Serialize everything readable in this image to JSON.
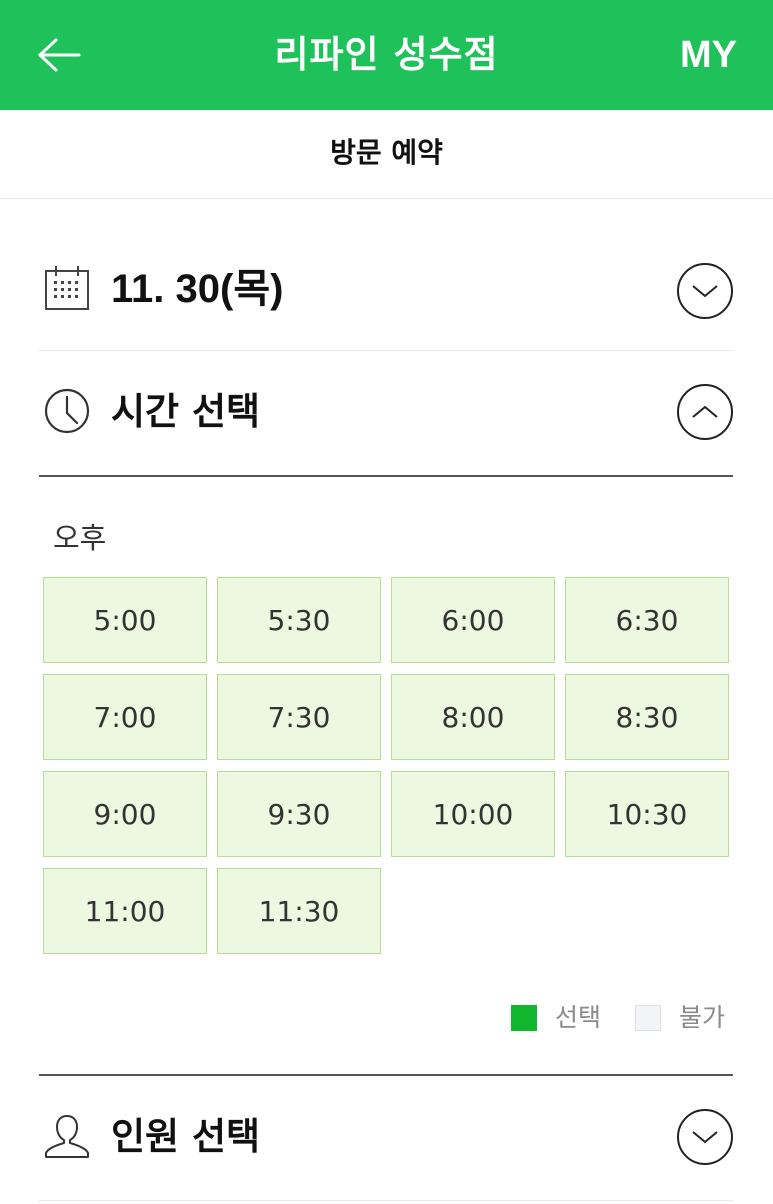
{
  "header": {
    "title": "리파인 성수점",
    "my_label": "MY",
    "bg_color": "#1ec15a"
  },
  "subheader": {
    "title": "방문 예약"
  },
  "date_section": {
    "icon": "calendar-icon",
    "value": "11. 30(목)",
    "toggle": "chevron-down-icon"
  },
  "time_section": {
    "icon": "clock-icon",
    "label": "시간 선택",
    "toggle": "chevron-up-icon",
    "period_label": "오후",
    "slots": [
      "5:00",
      "5:30",
      "6:00",
      "6:30",
      "7:00",
      "7:30",
      "8:00",
      "8:30",
      "9:00",
      "9:30",
      "10:00",
      "10:30",
      "11:00",
      "11:30"
    ],
    "slot_color": "#ecf8df"
  },
  "legend": {
    "selected_label": "선택",
    "selected_color": "#10b62d",
    "unavailable_label": "불가",
    "unavailable_color": "#f2f4f6"
  },
  "people_section": {
    "icon": "person-icon",
    "label": "인원 선택",
    "toggle": "chevron-down-icon"
  }
}
